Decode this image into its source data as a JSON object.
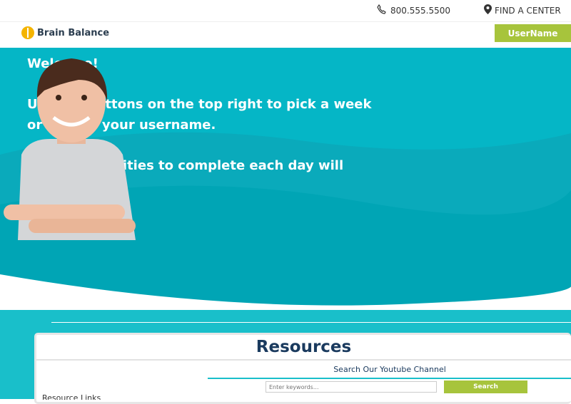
{
  "topbar": {
    "phone": "800.555.5500",
    "find_center": "FIND A CENTER"
  },
  "navbar": {
    "logo_text": "Brain Balance",
    "username_button": "UserName"
  },
  "hero": {
    "welcome": "Welcome!",
    "line1": "Use the buttons on the top right to pick a week or choose your username.",
    "line2": "A list of activities to complete each day will appear!"
  },
  "resources": {
    "title": "Resources",
    "youtube_title": "Search Our Youtube Channel",
    "search_placeholder": "Enter keywords...",
    "search_button": "Search",
    "partial_label": "Resource Links"
  },
  "colors": {
    "teal": "#05b6c6",
    "green": "#a7c43c",
    "navy": "#1a3a5e"
  }
}
